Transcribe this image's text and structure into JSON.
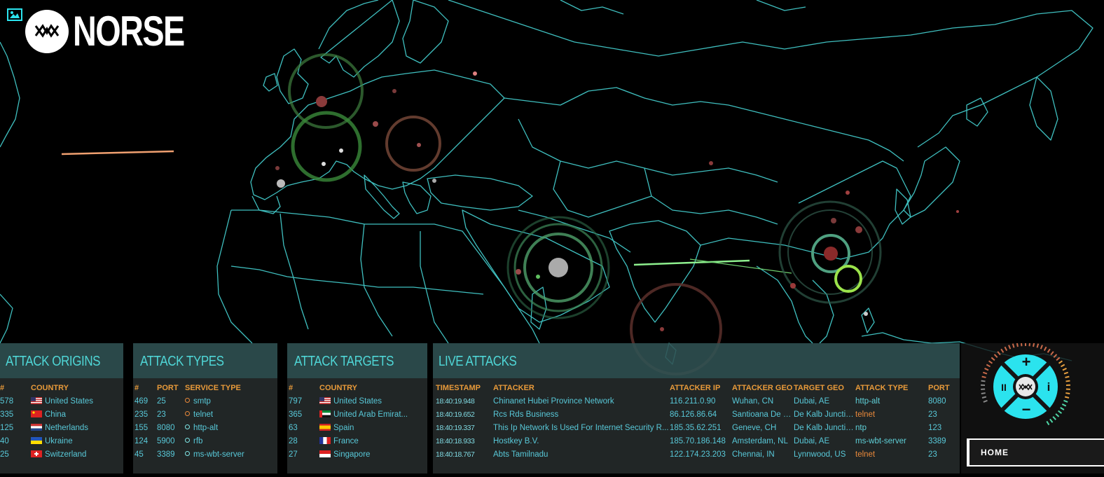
{
  "brand": {
    "name": "NORSE"
  },
  "colors": {
    "accent": "#4fd6d6",
    "header_orange": "#e89a3a",
    "panel": "#2c5052",
    "control": "#2be3ee"
  },
  "origins": {
    "title": "ATTACK ORIGINS",
    "headers": {
      "num": "#",
      "country": "COUNTRY"
    },
    "rows": [
      {
        "num": "578",
        "country": "United States",
        "flag": "us"
      },
      {
        "num": "335",
        "country": "China",
        "flag": "cn"
      },
      {
        "num": "125",
        "country": "Netherlands",
        "flag": "nl"
      },
      {
        "num": "40",
        "country": "Ukraine",
        "flag": "ua"
      },
      {
        "num": "25",
        "country": "Switzerland",
        "flag": "ch"
      }
    ]
  },
  "types": {
    "title": "ATTACK TYPES",
    "headers": {
      "num": "#",
      "port": "PORT",
      "service": "SERVICE TYPE"
    },
    "rows": [
      {
        "num": "469",
        "port": "25",
        "service": "smtp",
        "color": "#e8883a"
      },
      {
        "num": "235",
        "port": "23",
        "service": "telnet",
        "color": "#e8883a"
      },
      {
        "num": "155",
        "port": "8080",
        "service": "http-alt",
        "color": "#7fe6e6"
      },
      {
        "num": "124",
        "port": "5900",
        "service": "rfb",
        "color": "#7fe6e6"
      },
      {
        "num": "45",
        "port": "3389",
        "service": "ms-wbt-server",
        "color": "#7fe6e6"
      }
    ]
  },
  "targets": {
    "title": "ATTACK TARGETS",
    "headers": {
      "num": "#",
      "country": "COUNTRY"
    },
    "rows": [
      {
        "num": "797",
        "country": "United States",
        "flag": "us"
      },
      {
        "num": "365",
        "country": "United Arab Emirat...",
        "flag": "ae"
      },
      {
        "num": "63",
        "country": "Spain",
        "flag": "es"
      },
      {
        "num": "28",
        "country": "France",
        "flag": "fr"
      },
      {
        "num": "27",
        "country": "Singapore",
        "flag": "sg"
      }
    ]
  },
  "live": {
    "title": "LIVE ATTACKS",
    "headers": {
      "timestamp": "TIMESTAMP",
      "attacker": "ATTACKER",
      "attacker_ip": "ATTACKER IP",
      "attacker_geo": "ATTACKER GEO",
      "target_geo": "TARGET GEO",
      "attack_type": "ATTACK TYPE",
      "port": "PORT"
    },
    "rows": [
      {
        "timestamp": "18:40:19.948",
        "attacker": "Chinanet Hubei Province Network",
        "ip": "116.211.0.90",
        "attacker_geo": "Wuhan, CN",
        "target_geo": "Dubai, AE",
        "type": "http-alt",
        "type_color": "#5fd0d8",
        "port": "8080"
      },
      {
        "timestamp": "18:40:19.652",
        "attacker": "Rcs Rds Business",
        "ip": "86.126.86.64",
        "attacker_geo": "Santioana De M...",
        "target_geo": "De Kalb Junctio...",
        "type": "telnet",
        "type_color": "#e8883a",
        "port": "23"
      },
      {
        "timestamp": "18:40:19.337",
        "attacker": "This Ip Network Is Used For Internet Security R...",
        "ip": "185.35.62.251",
        "attacker_geo": "Geneve, CH",
        "target_geo": "De Kalb Junctio...",
        "type": "ntp",
        "type_color": "#5fd0d8",
        "port": "123"
      },
      {
        "timestamp": "18:40:18.933",
        "attacker": "Hostkey B.V.",
        "ip": "185.70.186.148",
        "attacker_geo": "Amsterdam, NL",
        "target_geo": "Dubai, AE",
        "type": "ms-wbt-server",
        "type_color": "#5fd0d8",
        "port": "3389"
      },
      {
        "timestamp": "18:40:18.767",
        "attacker": "Abts Tamilnadu",
        "ip": "122.174.23.203",
        "attacker_geo": "Chennai, IN",
        "target_geo": "Lynnwood, US",
        "type": "telnet",
        "type_color": "#e8883a",
        "port": "23"
      }
    ]
  },
  "controls": {
    "plus": "+",
    "minus": "−",
    "pause": "II",
    "info": "i"
  },
  "nav": {
    "home_label": "HOME"
  }
}
